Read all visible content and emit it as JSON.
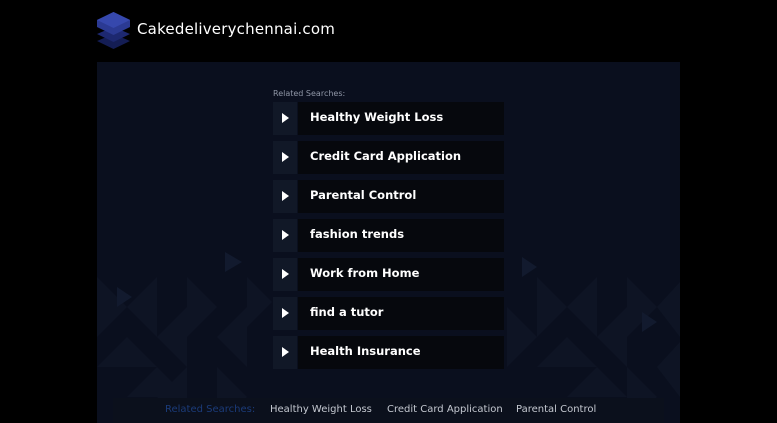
{
  "header": {
    "site_name": "Cakedeliverychennai.com",
    "logo_icon": "stacked-layers-icon"
  },
  "related": {
    "label": "Related Searches:",
    "items": [
      {
        "label": "Healthy Weight Loss"
      },
      {
        "label": "Credit Card Application"
      },
      {
        "label": "Parental Control"
      },
      {
        "label": "fashion trends"
      },
      {
        "label": "Work from Home"
      },
      {
        "label": "find a tutor"
      },
      {
        "label": "Health Insurance"
      }
    ],
    "item_icon": "play-arrow-icon"
  },
  "footer": {
    "label": "Related Searches:",
    "links": [
      {
        "label": "Healthy Weight Loss"
      },
      {
        "label": "Credit Card Application"
      },
      {
        "label": "Parental Control"
      }
    ]
  },
  "colors": {
    "background": "#000000",
    "panel": "#0a0f1e",
    "arrow_box": "#111827",
    "item_body": "#06080d",
    "footer_label": "#1b3b79",
    "logo_top": "#2b3a93",
    "logo_bottom": "#1a2566"
  }
}
